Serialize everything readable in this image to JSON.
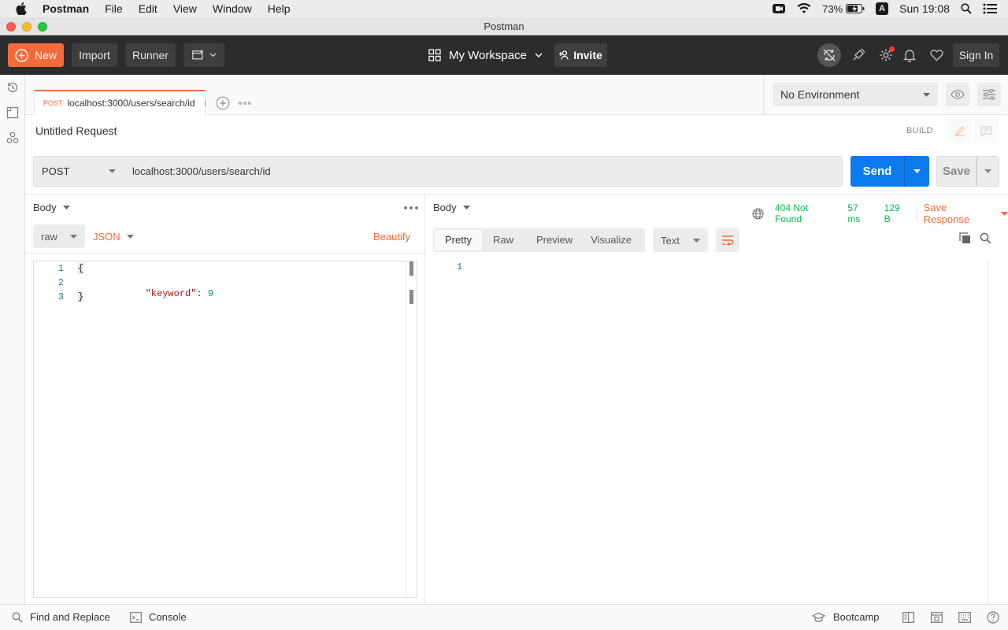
{
  "menubar": {
    "app": "Postman",
    "items": [
      "File",
      "Edit",
      "View",
      "Window",
      "Help"
    ],
    "battery": "73%",
    "input_source": "A",
    "clock": "Sun 19:08"
  },
  "window_title": "Postman",
  "header": {
    "new_label": "New",
    "import_label": "Import",
    "runner_label": "Runner",
    "workspace_label": "My Workspace",
    "invite_label": "Invite",
    "signin_label": "Sign In"
  },
  "tab": {
    "method": "POST",
    "title": "localhost:3000/users/search/id"
  },
  "environment": {
    "selected": "No Environment"
  },
  "request": {
    "name": "Untitled Request",
    "mode_label": "BUILD",
    "method": "POST",
    "url": "localhost:3000/users/search/id",
    "send_label": "Send",
    "save_label": "Save"
  },
  "request_body": {
    "section_label": "Body",
    "type_label": "raw",
    "format_label": "JSON",
    "beautify_label": "Beautify",
    "line_numbers": [
      "1",
      "2",
      "3"
    ],
    "lines": {
      "l1": "{",
      "l2_key": "\"keyword\"",
      "l2_colon": ":",
      "l2_value": "9",
      "l3": "}"
    }
  },
  "response": {
    "section_label": "Body",
    "status": "404 Not Found",
    "time": "57 ms",
    "size": "129 B",
    "save_response_label": "Save Response",
    "view_tabs": [
      "Pretty",
      "Raw",
      "Preview",
      "Visualize"
    ],
    "format_label": "Text",
    "line_numbers": [
      "1"
    ]
  },
  "statusbar": {
    "find_replace_label": "Find and Replace",
    "console_label": "Console",
    "bootcamp_label": "Bootcamp"
  },
  "colors": {
    "accent_orange": "#f26b3a",
    "send_blue": "#097bed",
    "status_green": "#0cbb52",
    "header_dark": "#2c2c2c"
  }
}
